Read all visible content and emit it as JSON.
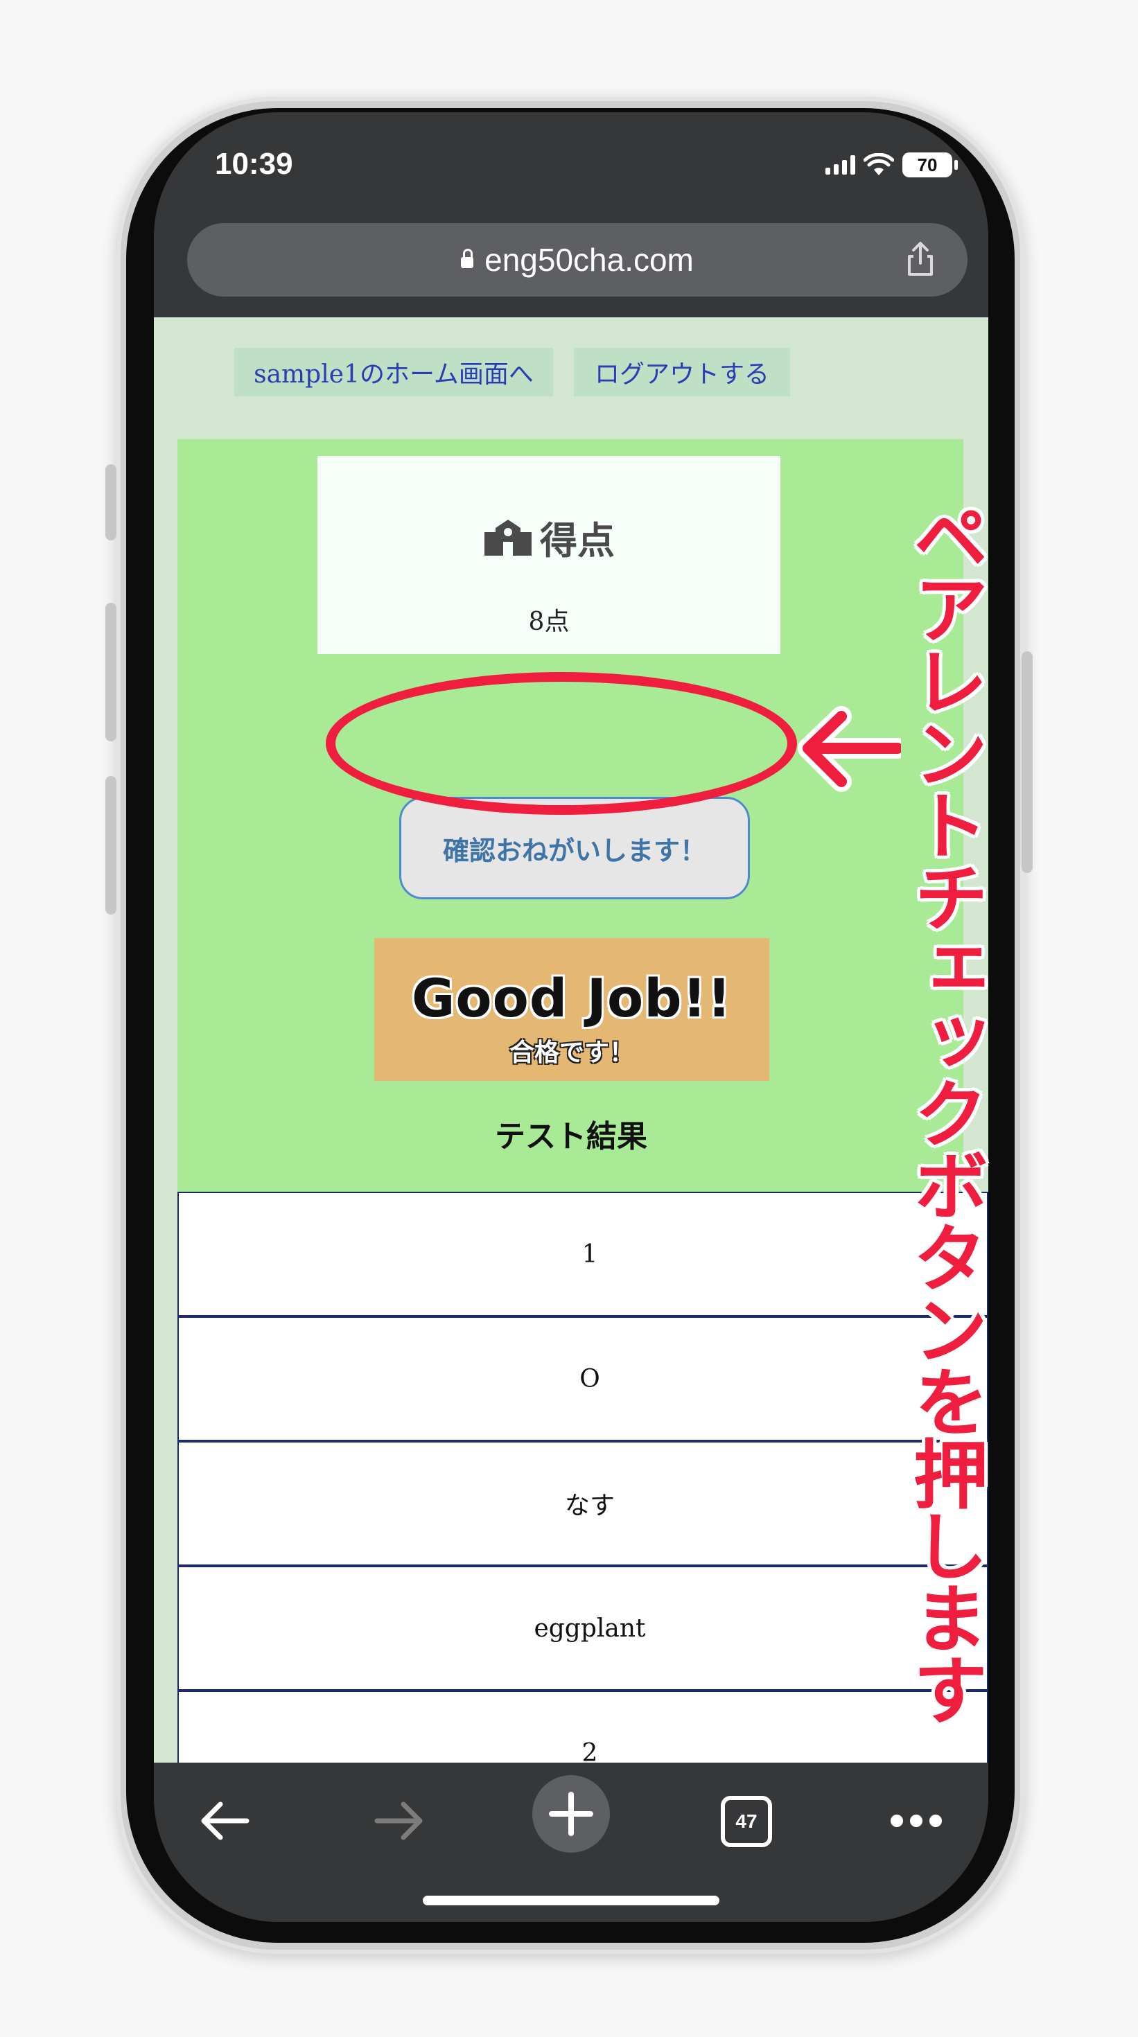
{
  "status": {
    "time": "10:39",
    "battery": "70"
  },
  "browser": {
    "url": "eng50cha.com",
    "tab_count": "47"
  },
  "nav": {
    "home_link": "sample1のホーム画面へ",
    "logout_link": "ログアウトする"
  },
  "score": {
    "title": "得点",
    "value": "8点"
  },
  "confirm_button": "確認おねがいします！",
  "goodjob": {
    "main": "Good Job!!",
    "sub": "合格です！"
  },
  "result_heading": "テスト結果",
  "results": [
    "1",
    "O",
    "なす",
    "eggplant",
    "2"
  ],
  "annotation": {
    "text": "ペアレントチェックボタンを押します",
    "color": "#ef1d3e"
  }
}
